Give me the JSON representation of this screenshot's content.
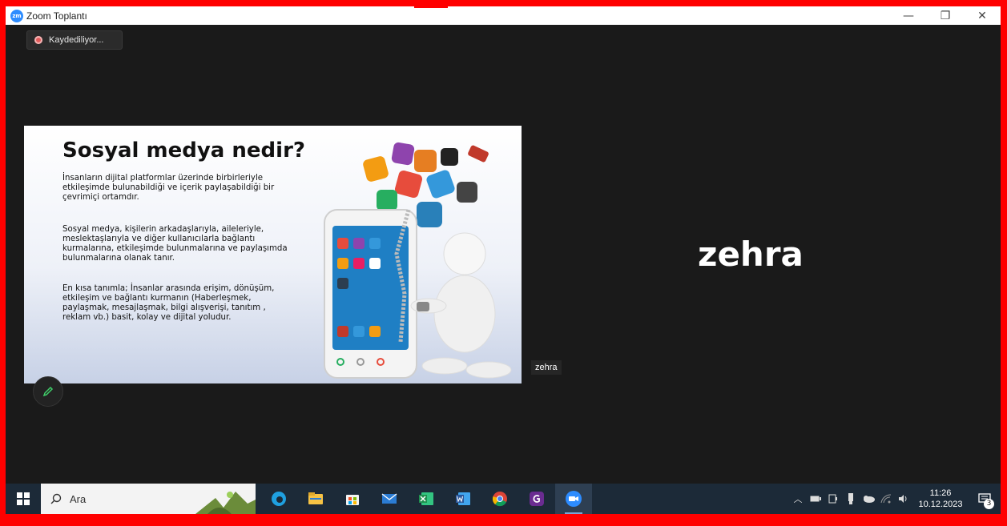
{
  "window": {
    "title": "Zoom Toplantı",
    "app_logo_text": "zm",
    "minimize_glyph": "—",
    "restore_glyph": "❐",
    "close_glyph": "✕"
  },
  "recording": {
    "label": "Kaydediliyor..."
  },
  "slide": {
    "title": "Sosyal medya nedir?",
    "paragraphs": [
      "İnsanların dijital platformlar üzerinde birbirleriyle\netkileşimde bulunabildiği ve içerik paylaşabildiği bir\nçevrimiçi ortamdır.",
      " Sosyal medya, kişilerin arkadaşlarıyla, aileleriyle,\nmeslektaşlarıyla ve diğer kullanıcılarla bağlantı\nkurmalarına, etkileşimde bulunmalarına ve paylaşımda\nbulunmalarına olanak tanır.",
      "En kısa tanımla; İnsanlar arasında erişim, dönüşüm,\netkileşim ve bağlantı kurmanın (Haberleşmek,\npaylaşmak, mesajlaşmak, bilgi alışverişi, tanıtım ,\nreklam vb.) basit, kolay ve dijital yoludur."
    ]
  },
  "participant": {
    "name_large": "zehra",
    "name_tag": "zehra"
  },
  "taskbar": {
    "search_placeholder": "Ara",
    "apps": [
      {
        "name": "edge-icon",
        "color": "#1fa0e0"
      },
      {
        "name": "file-explorer-icon",
        "color": "#f6c244"
      },
      {
        "name": "store-icon",
        "color": "#f2f2f2"
      },
      {
        "name": "mail-icon",
        "color": "#2b7cd3"
      },
      {
        "name": "excel-icon",
        "color": "#1f8f4e"
      },
      {
        "name": "word-icon",
        "color": "#2b579a"
      },
      {
        "name": "chrome-icon",
        "color": "#db4437"
      },
      {
        "name": "pdf-icon",
        "color": "#6a2c91"
      },
      {
        "name": "zoom-icon",
        "color": "#2d8cff"
      }
    ],
    "clock_time": "11:26",
    "clock_date": "10.12.2023",
    "notification_count": "3"
  },
  "colors": {
    "border": "#ff0000",
    "meeting_bg": "#1a1a1a",
    "taskbar_bg": "#1c2a38",
    "zoom_blue": "#2d8cff"
  }
}
